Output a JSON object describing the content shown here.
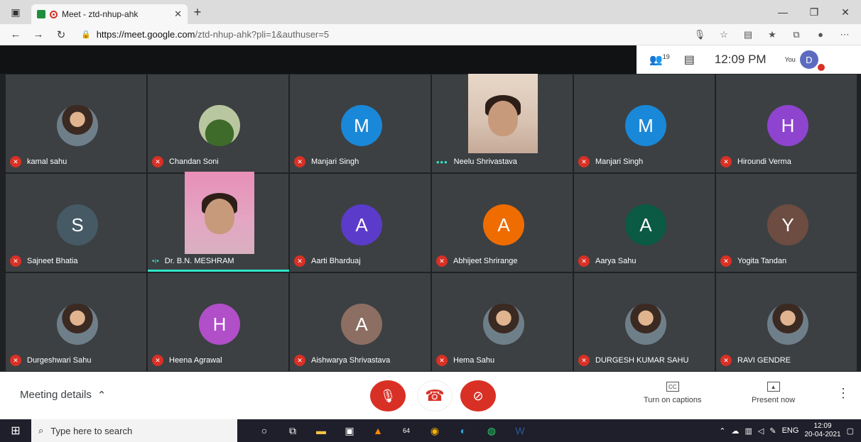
{
  "browser": {
    "tab_title": "Meet - ztd-nhup-ahk",
    "url_host": "https://meet.google.com",
    "url_rest": "/ztd-nhup-ahk?pli=1&authuser=5"
  },
  "meet_top": {
    "people_count": "19",
    "time": "12:09 PM",
    "you_label": "You",
    "avatar_letter": "D"
  },
  "participants": [
    {
      "name": "kamal sahu",
      "type": "photo",
      "color": "#6f7f8a"
    },
    {
      "name": "Chandan Soni",
      "type": "photo",
      "color": "#3f6b2a"
    },
    {
      "name": "Manjari Singh",
      "type": "letter",
      "letter": "M",
      "color": "#1a88d8"
    },
    {
      "name": "Neelu Shrivastava",
      "type": "video",
      "color": "#d8c2b2"
    },
    {
      "name": "Manjari Singh",
      "type": "letter",
      "letter": "M",
      "color": "#1a88d8"
    },
    {
      "name": "Hiroundi Verma",
      "type": "letter",
      "letter": "H",
      "color": "#8e44cf"
    },
    {
      "name": "Sajneet Bhatia",
      "type": "letter",
      "letter": "S",
      "color": "#455a64"
    },
    {
      "name": "Dr. B.N. MESHRAM",
      "type": "video",
      "color": "#e88fb8"
    },
    {
      "name": "Aarti Bharduaj",
      "type": "letter",
      "letter": "A",
      "color": "#5b3bc9"
    },
    {
      "name": "Abhijeet Shrirange",
      "type": "letter",
      "letter": "A",
      "color": "#ef6c00"
    },
    {
      "name": "Aarya Sahu",
      "type": "letter",
      "letter": "A",
      "color": "#0b5a43"
    },
    {
      "name": "Yogita Tandan",
      "type": "letter",
      "letter": "Y",
      "color": "#6d4c41"
    },
    {
      "name": "Durgeshwari Sahu",
      "type": "photo",
      "color": "#6f7f8a"
    },
    {
      "name": "Heena Agrawal",
      "type": "letter",
      "letter": "H",
      "color": "#b04fc8"
    },
    {
      "name": "Aishwarya Shrivastava",
      "type": "letter",
      "letter": "A",
      "color": "#8d6e63"
    },
    {
      "name": "Hema Sahu",
      "type": "photo",
      "color": "#c07890"
    },
    {
      "name": "DURGESH KUMAR SAHU",
      "type": "photo",
      "color": "#7a8a6a"
    },
    {
      "name": "RAVI GENDRE",
      "type": "photo",
      "color": "#9a7a6a"
    }
  ],
  "bottom": {
    "meeting_details": "Meeting details",
    "captions": "Turn on captions",
    "present": "Present now"
  },
  "taskbar": {
    "search_placeholder": "Type here to search",
    "lang": "ENG",
    "time": "12:09",
    "date": "20-04-2021",
    "badge": "64"
  }
}
